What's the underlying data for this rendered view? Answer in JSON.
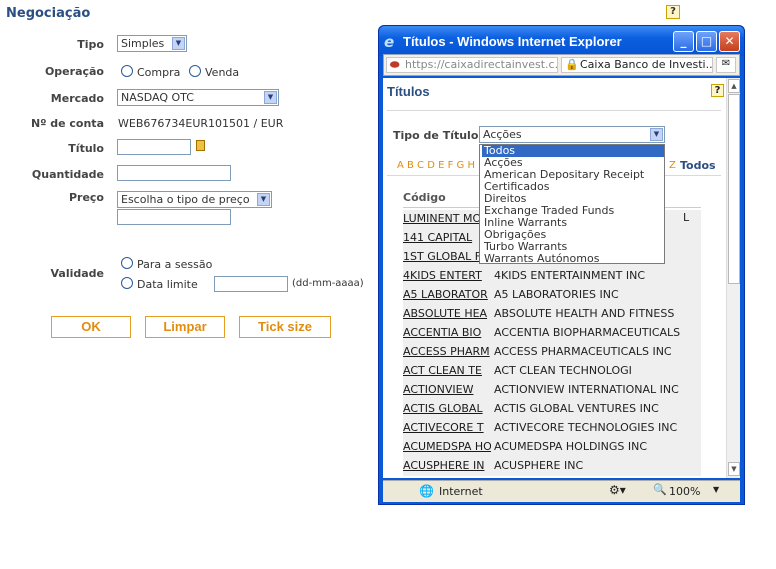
{
  "page": {
    "title": "Negociação",
    "help_symbol": "?"
  },
  "form": {
    "tipo_label": "Tipo",
    "tipo_value": "Simples",
    "operacao_label": "Operação",
    "operacao_option1": "Compra",
    "operacao_option2": "Venda",
    "mercado_label": "Mercado",
    "mercado_value": "NASDAQ OTC",
    "conta_label": "Nº de conta",
    "conta_value": "WEB676734EUR101501 / EUR",
    "titulo_label": "Título",
    "quantidade_label": "Quantidade",
    "preco_label": "Preço",
    "preco_value": "Escolha o tipo de preço",
    "validade_label": "Validade",
    "validade_option1": "Para a sessão",
    "validade_option2": "Data limite",
    "date_hint": "(dd-mm-aaaa)",
    "buttons": [
      "OK",
      "Limpar",
      "Tick size"
    ]
  },
  "ie": {
    "window_title": "Títulos - Windows Internet Explorer",
    "url": "https://caixadirectainvest.c...",
    "security_label": "Caixa Banco de Investi...",
    "status_zone": "Internet",
    "zoom": "100%",
    "inner_title": "Títulos",
    "tipo_titulo_label": "Tipo de Título",
    "tipo_titulo_value": "Acções",
    "alphabet_visible": "A B C D E F G H",
    "alphabet_end": "Z",
    "todos_link": "Todos",
    "code_header": "Código",
    "hidden_row_tail": "L",
    "dropdown_options": [
      "Todos",
      "Acções",
      "American Depositary Receipt",
      "Certificados",
      "Direitos",
      "Exchange Traded Funds",
      "Inline Warrants",
      "Obrigações",
      "Turbo Warrants",
      "Warrants Autónomos"
    ],
    "rows": [
      {
        "code": "LUMINENT MO",
        "name": ""
      },
      {
        "code": "141 CAPITAL",
        "name": ""
      },
      {
        "code": "1ST GLOBAL F",
        "name": ""
      },
      {
        "code": "4KIDS ENTERT",
        "name": "4KIDS ENTERTAINMENT INC"
      },
      {
        "code": "A5 LABORATOR",
        "name": "A5 LABORATORIES INC"
      },
      {
        "code": "ABSOLUTE HEA",
        "name": "ABSOLUTE HEALTH AND FITNESS"
      },
      {
        "code": "ACCENTIA BIO",
        "name": "ACCENTIA BIOPHARMACEUTICALS"
      },
      {
        "code": "ACCESS PHARM",
        "name": "ACCESS PHARMACEUTICALS INC"
      },
      {
        "code": "ACT CLEAN TE",
        "name": "ACT CLEAN TECHNOLOGI"
      },
      {
        "code": "ACTIONVIEW",
        "name": "ACTIONVIEW INTERNATIONAL INC"
      },
      {
        "code": "ACTIS GLOBAL",
        "name": "ACTIS GLOBAL VENTURES INC"
      },
      {
        "code": "ACTIVECORE T",
        "name": "ACTIVECORE TECHNOLOGIES INC"
      },
      {
        "code": "ACUMEDSPA HO",
        "name": "ACUMEDSPA HOLDINGS INC"
      },
      {
        "code": "ACUSPHERE IN",
        "name": "ACUSPHERE INC"
      }
    ]
  }
}
